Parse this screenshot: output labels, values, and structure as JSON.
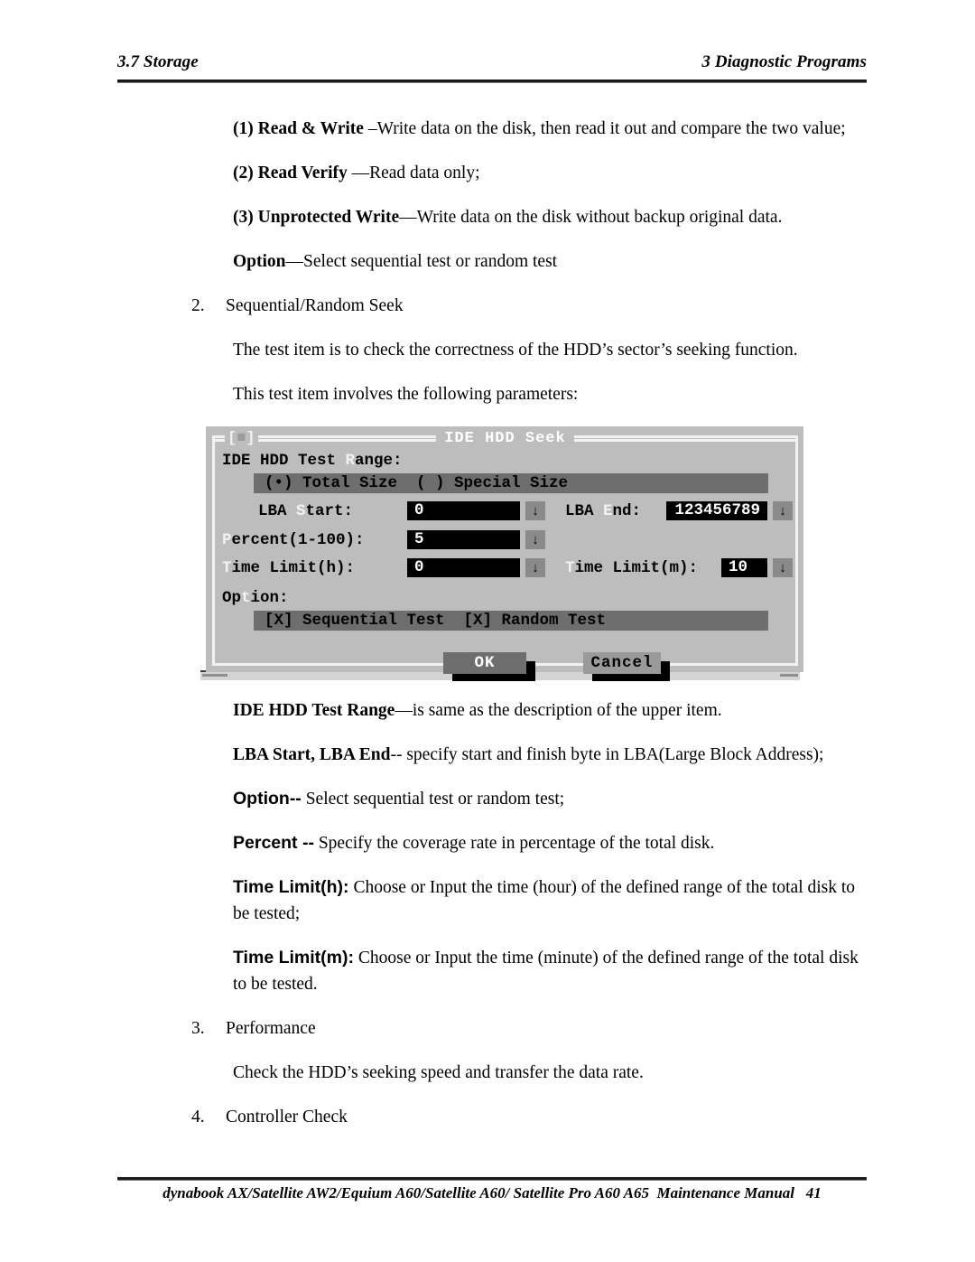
{
  "header": {
    "left": "3.7 Storage",
    "right": "3  Diagnostic Programs"
  },
  "body": {
    "p1_bold": "(1) Read & Write ",
    "p1_rest": "–Write data on the disk, then read it out and compare the two value;",
    "p2_bold": "(2) Read Verify ",
    "p2_rest": "—Read data only;",
    "p3_bold": "(3) Unprotected Write",
    "p3_rest": "—Write data on the disk without backup original data.",
    "p4_bold": "Option",
    "p4_rest": "—Select sequential test or random test",
    "item2_num": "2.",
    "item2_text": "Sequential/Random Seek",
    "p5": "The test item is to check the correctness of the HDD’s sector’s seeking function.",
    "p6": "This test item involves the following parameters:",
    "p7_bold": "IDE HDD Test Range",
    "p7_rest": "—is same as the description  of  the upper item.",
    "p8_bold": "LBA Start, LBA End",
    "p8_rest": "-- specify start and finish byte in LBA(Large Block Address);",
    "p9_bold": "Option--",
    "p9_rest": " Select sequential test or random test;",
    "p10_bold": "Percent --",
    "p10_rest": " Specify the coverage rate in percentage of the total disk.",
    "p11_bold": "Time Limit(h):",
    "p11_rest": " Choose or Input the time (hour) of the defined range of the total disk to be tested;",
    "p12_bold": "Time Limit(m):",
    "p12_rest": " Choose or Input the time (minute) of the defined range of the total disk to be tested.",
    "item3_num": "3.",
    "item3_text": "Performance",
    "p13": "Check the HDD’s seeking speed and transfer the data rate.",
    "item4_num": "4.",
    "item4_text": "Controller Check"
  },
  "dialog": {
    "close_box_left": "[",
    "close_box_sq": "■",
    "close_box_right": "]",
    "title": "IDE HDD Seek",
    "test_range_label_pre": "IDE HDD Test ",
    "test_range_label_key": "R",
    "test_range_label_post": "ange:",
    "radio_band": "(•) Total Size  ( ) Special Size",
    "lba_start_pre": "LBA ",
    "lba_start_key": "S",
    "lba_start_post": "tart:",
    "lba_start_value": "0",
    "lba_end_pre": "LBA ",
    "lba_end_key": "E",
    "lba_end_post": "nd:",
    "lba_end_value": "123456789",
    "percent_key": "P",
    "percent_post": "ercent(1-100):",
    "percent_value": "5",
    "time_h_key": "T",
    "time_h_post": "ime Limit(h):",
    "time_h_value": "0",
    "time_m_key": "T",
    "time_m_post": "ime Limit(m):",
    "time_m_value": "10",
    "option_pre": "Op",
    "option_key": "t",
    "option_post": "ion:",
    "option_band": "[X] Sequential Test  [X] Random Test",
    "ok_label": "OK",
    "cancel_label": "Cancel",
    "arrow_glyph": "↓",
    "colors": {
      "dialog_face": "#bdbdbd",
      "band": "#6e6e6e",
      "field_bg": "#000000",
      "field_fg": "#ffffff",
      "arrow_bg": "#8a8a8a",
      "ok_bg": "#6e6e6e",
      "cancel_bg": "#9a9a9a",
      "border_light": "#f2f2f2"
    }
  },
  "footer": {
    "text": "dynabook AX/Satellite AW2/Equium A60/Satellite A60/ Satellite Pro A60 A65  Maintenance Manual   41"
  }
}
